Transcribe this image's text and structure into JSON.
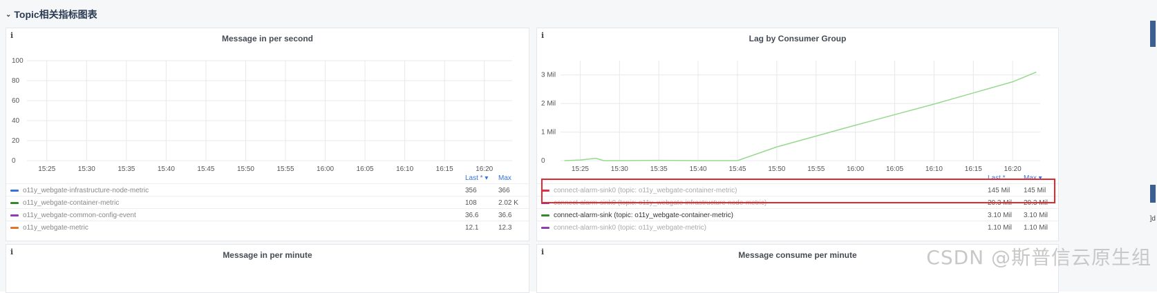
{
  "row_header": {
    "label": "Topic相关指标图表"
  },
  "panels": {
    "msg_in_sec": {
      "title": "Message in per second",
      "info_glyph": "i",
      "chart_data": {
        "type": "line",
        "title": "Message in per second",
        "y_ticks": [
          "100",
          "80",
          "60",
          "40",
          "20",
          "0"
        ],
        "ylim": [
          0,
          100
        ],
        "x_ticks": [
          "15:25",
          "15:30",
          "15:35",
          "15:40",
          "15:45",
          "15:50",
          "15:55",
          "16:00",
          "16:05",
          "16:10",
          "16:15",
          "16:20"
        ],
        "grid": true,
        "series": []
      },
      "legend": {
        "col_last": "Last * ▾",
        "col_max": "Max",
        "items": [
          {
            "name": "o11y_webgate-infrastructure-node-metric",
            "color": "#3274d9",
            "last": "356",
            "max": "366"
          },
          {
            "name": "o11y_webgate-container-metric",
            "color": "#37872d",
            "last": "108",
            "max": "2.02 K"
          },
          {
            "name": "o11y_webgate-common-config-event",
            "color": "#8f3bb8",
            "last": "36.6",
            "max": "36.6"
          },
          {
            "name": "o11y_webgate-metric",
            "color": "#e0752d",
            "last": "12.1",
            "max": "12.3"
          }
        ]
      }
    },
    "lag_group": {
      "title": "Lag by Consumer Group",
      "info_glyph": "i",
      "chart_data": {
        "type": "line",
        "title": "Lag by Consumer Group",
        "y_ticks": [
          "3 Mil",
          "2 Mil",
          "1 Mil",
          "0"
        ],
        "ylim": [
          0,
          3500000
        ],
        "x_ticks": [
          "15:25",
          "15:30",
          "15:35",
          "15:40",
          "15:45",
          "15:50",
          "15:55",
          "16:00",
          "16:05",
          "16:10",
          "16:15",
          "16:20"
        ],
        "grid": true,
        "series": [
          {
            "color": "#96d98d",
            "x": [
              "15:23",
              "15:25",
              "15:27",
              "15:28",
              "15:30",
              "15:35",
              "15:40",
              "15:45",
              "15:50",
              "15:55",
              "16:00",
              "16:05",
              "16:10",
              "16:15",
              "16:20",
              "16:23"
            ],
            "values": [
              0,
              20000,
              80000,
              0,
              0,
              10000,
              0,
              0,
              480000,
              860000,
              1240000,
              1610000,
              1980000,
              2370000,
              2760000,
              3100000
            ]
          }
        ]
      },
      "legend": {
        "col_last": "Last *",
        "col_max": "Max ▾",
        "items": [
          {
            "name": "connect-alarm-sink0 (topic: o11y_webgate-container-metric)",
            "color": "#e02f44",
            "last": "145 Mil",
            "max": "145 Mil",
            "style": "dim"
          },
          {
            "name": "connect-alarm-sink0 (topic: o11y_webgate-infrastructure-node-metric)",
            "color": "#8f3bb8",
            "last": "20.3 Mil",
            "max": "20.3 Mil",
            "style": "dim"
          },
          {
            "name": "connect-alarm-sink (topic: o11y_webgate-container-metric)",
            "color": "#37872d",
            "last": "3.10 Mil",
            "max": "3.10 Mil",
            "style": "strong"
          },
          {
            "name": "connect-alarm-sink0 (topic: o11y_webgate-metric)",
            "color": "#8f3bb8",
            "last": "1.10 Mil",
            "max": "1.10 Mil",
            "style": "dim"
          }
        ]
      }
    },
    "msg_in_min": {
      "title": "Message in per minute",
      "info_glyph": "i"
    },
    "msg_consume_min": {
      "title": "Message consume per minute",
      "info_glyph": "i"
    }
  },
  "watermark": "CSDN @斯普信云原生组",
  "side_text": "]d"
}
